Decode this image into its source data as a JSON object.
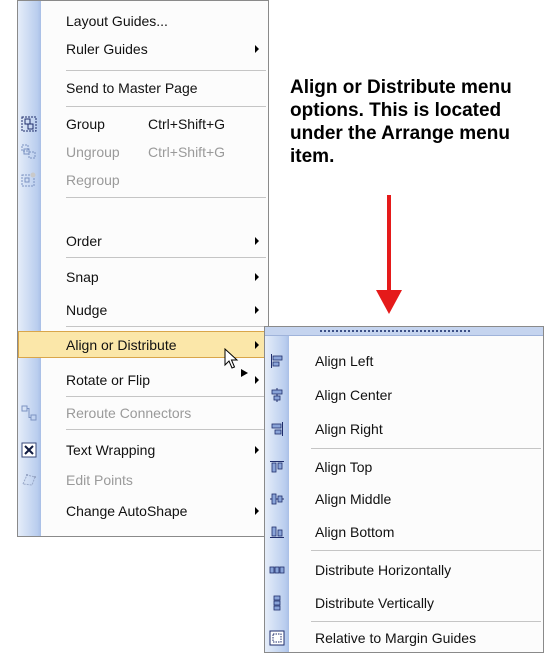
{
  "annotation": {
    "text": "Align or Distribute menu options. This is located under the Arrange menu item."
  },
  "main_menu": {
    "items": [
      {
        "label": "Layout Guides...",
        "shortcut": "",
        "enabled": true,
        "submenu": false,
        "icon": ""
      },
      {
        "label": "Ruler Guides",
        "shortcut": "",
        "enabled": true,
        "submenu": true,
        "icon": ""
      },
      {
        "label": "Send to Master Page",
        "shortcut": "",
        "enabled": true,
        "submenu": false,
        "icon": ""
      },
      {
        "label": "Group",
        "shortcut": "Ctrl+Shift+G",
        "enabled": true,
        "submenu": false,
        "icon": "group-icon"
      },
      {
        "label": "Ungroup",
        "shortcut": "Ctrl+Shift+G",
        "enabled": false,
        "submenu": false,
        "icon": "ungroup-icon"
      },
      {
        "label": "Regroup",
        "shortcut": "",
        "enabled": false,
        "submenu": false,
        "icon": "regroup-icon"
      },
      {
        "label": "Order",
        "shortcut": "",
        "enabled": true,
        "submenu": true,
        "icon": ""
      },
      {
        "label": "Snap",
        "shortcut": "",
        "enabled": true,
        "submenu": true,
        "icon": ""
      },
      {
        "label": "Nudge",
        "shortcut": "",
        "enabled": true,
        "submenu": true,
        "icon": ""
      },
      {
        "label": "Align or Distribute",
        "shortcut": "",
        "enabled": true,
        "submenu": true,
        "icon": "",
        "highlighted": true
      },
      {
        "label": "Rotate or Flip",
        "shortcut": "",
        "enabled": true,
        "submenu": true,
        "icon": ""
      },
      {
        "label": "Reroute Connectors",
        "shortcut": "",
        "enabled": false,
        "submenu": false,
        "icon": "reroute-connectors-icon"
      },
      {
        "label": "Text Wrapping",
        "shortcut": "",
        "enabled": true,
        "submenu": true,
        "icon": "text-wrapping-icon"
      },
      {
        "label": "Edit Points",
        "shortcut": "",
        "enabled": false,
        "submenu": false,
        "icon": "edit-points-icon"
      },
      {
        "label": "Change AutoShape",
        "shortcut": "",
        "enabled": true,
        "submenu": true,
        "icon": ""
      }
    ]
  },
  "sub_menu": {
    "items": [
      {
        "label": "Align Left",
        "icon": "align-left-icon"
      },
      {
        "label": "Align Center",
        "icon": "align-center-icon"
      },
      {
        "label": "Align Right",
        "icon": "align-right-icon"
      },
      {
        "label": "Align Top",
        "icon": "align-top-icon"
      },
      {
        "label": "Align Middle",
        "icon": "align-middle-icon"
      },
      {
        "label": "Align Bottom",
        "icon": "align-bottom-icon"
      },
      {
        "label": "Distribute Horizontally",
        "icon": "distribute-horizontally-icon"
      },
      {
        "label": "Distribute Vertically",
        "icon": "distribute-vertically-icon"
      },
      {
        "label": "Relative to Margin Guides",
        "icon": "relative-to-margin-guides-icon"
      }
    ]
  },
  "colors": {
    "highlight": "#fbe7a9",
    "highlight_border": "#d9a64a",
    "gutter": "#b9cdee",
    "arrow": "#e51a1a",
    "disabled_text": "#9a9a9a"
  }
}
